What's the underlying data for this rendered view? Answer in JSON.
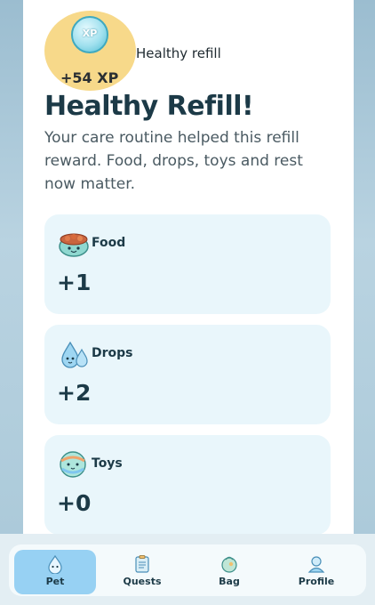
{
  "reward": {
    "badge_orb_text": "XP",
    "xp_amount": "+54 XP",
    "chip_label": "Healthy refill",
    "title": "Healthy Refill!",
    "subtitle": "Your care routine helped this refill reward. Food, drops, toys and rest now matter."
  },
  "cards": [
    {
      "label": "Food",
      "value": "+1",
      "icon": "food-bowl-icon"
    },
    {
      "label": "Drops",
      "value": "+2",
      "icon": "water-drops-icon"
    },
    {
      "label": "Toys",
      "value": "+0",
      "icon": "toy-ball-icon"
    }
  ],
  "nav": {
    "items": [
      {
        "label": "Pet",
        "icon": "pet-icon",
        "active": true
      },
      {
        "label": "Quests",
        "icon": "clipboard-icon",
        "active": false
      },
      {
        "label": "Bag",
        "icon": "bag-icon",
        "active": false
      },
      {
        "label": "Profile",
        "icon": "profile-icon",
        "active": false
      }
    ]
  },
  "colors": {
    "badge": "#f7d98a",
    "card_bg": "#e9f6fb",
    "nav_active": "#97d1f3",
    "heading": "#1c3a47"
  }
}
